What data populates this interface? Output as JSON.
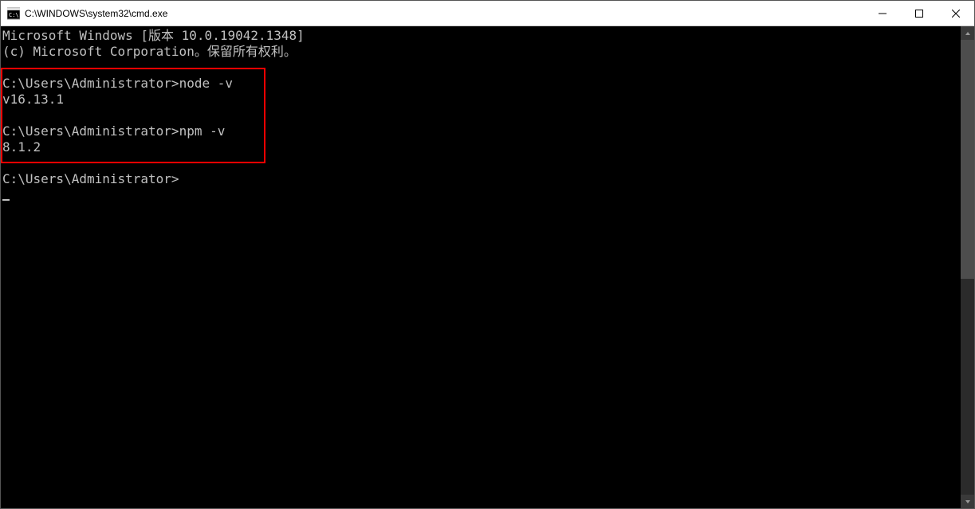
{
  "window": {
    "title": "C:\\WINDOWS\\system32\\cmd.exe"
  },
  "console": {
    "header_line1": "Microsoft Windows [版本 10.0.19042.1348]",
    "header_line2": "(c) Microsoft Corporation。保留所有权利。",
    "blank": "",
    "prompt1": "C:\\Users\\Administrator>",
    "cmd1": "node -v",
    "out1": "v16.13.1",
    "prompt2": "C:\\Users\\Administrator>",
    "cmd2": "npm -v",
    "out2": "8.1.2",
    "prompt3": "C:\\Users\\Administrator>"
  }
}
